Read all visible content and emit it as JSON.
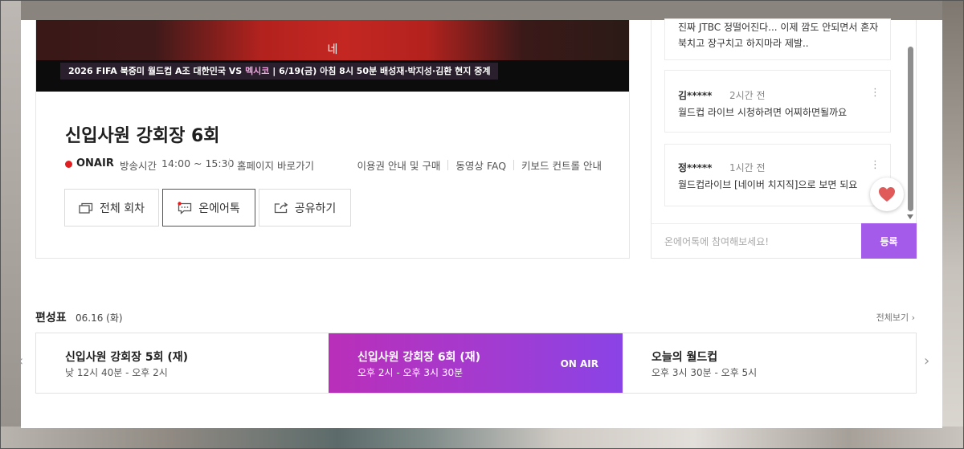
{
  "video": {
    "subtitle": "네",
    "ticker_prefix": "2026 FIFA 북중미 월드컵 A조 대한민국 VS ",
    "ticker_highlight": "멕시코",
    "ticker_suffix": "  |  6/19(금) 아침 8시 50분 배성재·박지성·김환 현지 중계"
  },
  "program": {
    "title": "신입사원 강회장 6회",
    "onair_label": "ONAIR",
    "airtime_label": "방송시간",
    "airtime_value": "14:00 ~ 15:30",
    "homepage_link": "홈페이지 바로가기",
    "links": [
      "이용권 안내 및 구매",
      "동영상 FAQ",
      "키보드 컨트롤 안내"
    ]
  },
  "buttons": {
    "all_episodes": "전체 회차",
    "on_air_talk": "온에어톡",
    "share": "공유하기"
  },
  "chat": {
    "comments": [
      {
        "user": "",
        "time": "",
        "body": "진짜 JTBC 정떨어진다... 이제 깜도 안되면서 혼자 북치고 장구치고 하지마라 제발.."
      },
      {
        "user": "김*****",
        "time": "2시간 전",
        "body": "월드컵 라이브 시청하려면 어찌하면될까요"
      },
      {
        "user": "정*****",
        "time": "1시간 전",
        "body": "월드컵라이브 [네이버 치지직]으로 보면 되요"
      }
    ],
    "input_placeholder": "온에어톡에 참여해보세요!",
    "submit_label": "등록"
  },
  "schedule": {
    "title": "편성표",
    "date": "06.16 (화)",
    "see_all": "전체보기",
    "items": [
      {
        "title": "신입사원 강회장 5회  (재)",
        "time": "낮 12시 40분 - 오후 2시"
      },
      {
        "title": "신입사원 강회장 6회  (재)",
        "time": "오후 2시 - 오후 3시 30분",
        "badge": "ON AIR"
      },
      {
        "title": "오늘의 월드컵",
        "time": "오후 3시 30분 - 오후 5시"
      }
    ]
  },
  "colors": {
    "accent_purple": "#a55bea",
    "onair_red": "#e02020",
    "current_gradient_start": "#b92fb9",
    "current_gradient_end": "#8a43e6",
    "heart": "#e05a5a"
  }
}
